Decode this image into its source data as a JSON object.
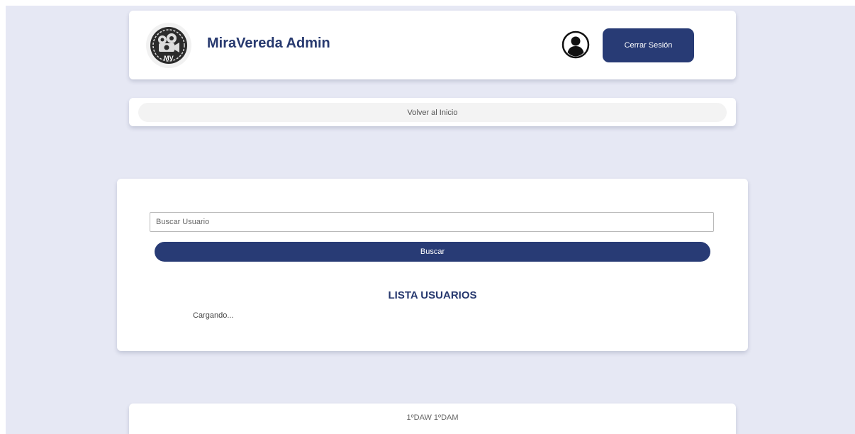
{
  "header": {
    "title": "MiraVereda Admin",
    "logo_text": "MV",
    "logout_label": "Cerrar Sesión"
  },
  "nav": {
    "back_label": "Volver al Inicio"
  },
  "search": {
    "placeholder": "Buscar Usuario",
    "value": "",
    "button_label": "Buscar"
  },
  "users": {
    "title": "LISTA USUARIOS",
    "status": "Cargando..."
  },
  "footer": {
    "text": "1ºDAW  1ºDAM"
  },
  "colors": {
    "primary": "#283b75",
    "title": "#27396f",
    "background": "#e6e8f4",
    "card": "#ffffff"
  }
}
